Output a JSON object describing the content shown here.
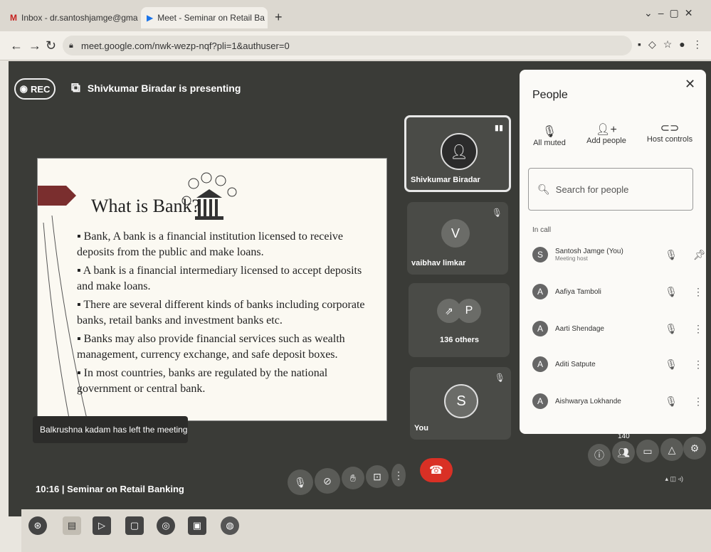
{
  "browser": {
    "tabs": [
      {
        "label": "Inbox - dr.santoshjamge@gmail.c",
        "icon": "gmail-icon"
      },
      {
        "label": "Meet - Seminar on Retail Ba",
        "icon": "meet-icon"
      }
    ],
    "new_tab": "+",
    "url": "meet.google.com/nwk-wezp-nqf?pli=1&authuser=0"
  },
  "meet": {
    "rec_label": "REC",
    "presenting": "Shivkumar Biradar is presenting",
    "slide": {
      "title": "What is Bank?",
      "bullets": [
        "Bank, A bank is a financial institution licensed to receive deposits from the public and make loans.",
        "A bank is a financial intermediary licensed to accept deposits and make loans.",
        "There are several different kinds of banks including corporate banks, retail banks and investment banks etc.",
        "Banks may also provide financial services such as wealth management, currency exchange, and safe deposit boxes.",
        "In most countries, banks are regulated by the national government or central bank."
      ]
    },
    "toast": "Balkrushna kadam has left the meeting",
    "tiles": {
      "presenter": "Shivkumar Biradar",
      "vaibhav": {
        "name": "vaibhav limkar",
        "initial": "V"
      },
      "others": {
        "label": "136 others",
        "initial": "P"
      },
      "you": {
        "name": "You",
        "initial": "S"
      }
    },
    "time": "10:16",
    "separator": "|",
    "meeting_title": "Seminar on Retail Banking",
    "participant_badge": "140"
  },
  "people": {
    "title": "People",
    "controls": [
      {
        "label": "All muted",
        "icon": "mic-off-icon"
      },
      {
        "label": "Add people",
        "icon": "add-person-icon"
      },
      {
        "label": "Host controls",
        "icon": "host-controls-icon"
      }
    ],
    "search_placeholder": "Search for people",
    "section": "In call",
    "list": [
      {
        "name": "Santosh Jamge (You)",
        "sub": "Meeting host",
        "initial": "S",
        "action": "pin"
      },
      {
        "name": "Aafiya Tamboli",
        "sub": "",
        "initial": "A",
        "action": "more"
      },
      {
        "name": "Aarti Shendage",
        "sub": "",
        "initial": "A",
        "action": "more"
      },
      {
        "name": "Aditi Satpute",
        "sub": "",
        "initial": "A",
        "action": "more"
      },
      {
        "name": "Aishwarya Lokhande",
        "sub": "",
        "initial": "A",
        "action": "more"
      }
    ]
  },
  "colors": {
    "meet_bg": "#3a3b37",
    "end_call": "#d93025",
    "panel": "#fbfaf7"
  }
}
